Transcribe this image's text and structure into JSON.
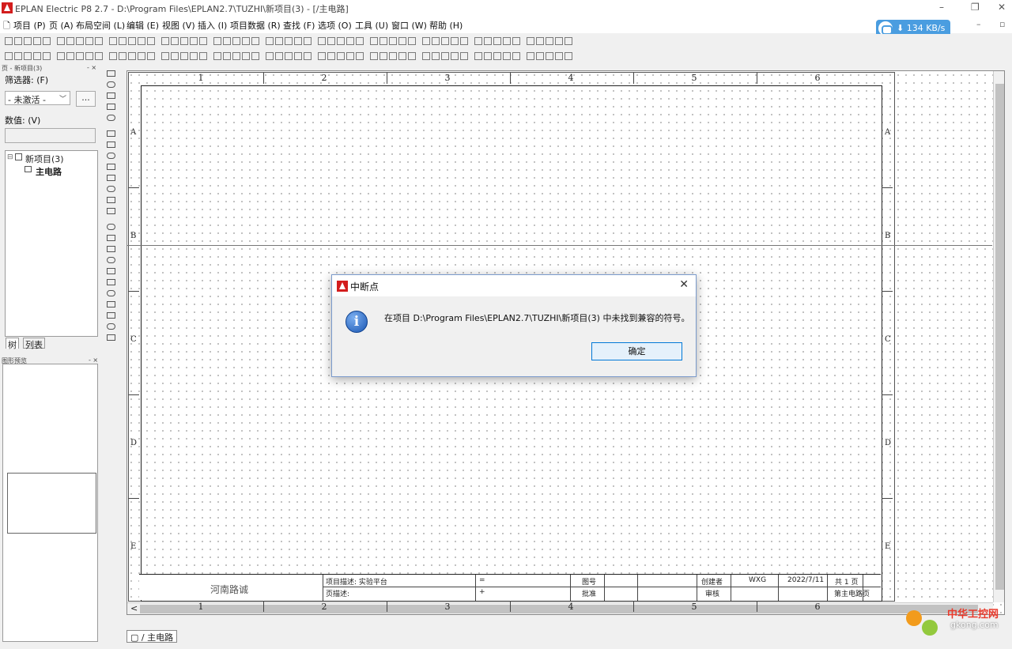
{
  "window": {
    "title": "EPLAN Electric P8 2.7 - D:\\Program Files\\EPLAN2.7\\TUZHI\\新项目(3) - [/主电路]",
    "controls": [
      "–",
      "❐",
      "✕"
    ],
    "mdi_controls": [
      "–",
      "▫"
    ]
  },
  "menu": [
    "项目 (P)",
    "页 (A)",
    "布局空间 (L)",
    "编辑 (E)",
    "视图 (V)",
    "插入 (I)",
    "项目数据 (R)",
    "查找 (F)",
    "选项 (O)",
    "工具 (U)",
    "窗口 (W)",
    "帮助 (H)"
  ],
  "net_speed": "134 KB/s",
  "left_panel": {
    "header": "页 - 新项目(3)",
    "filter_label": "筛选器: (F)",
    "filter_value": "- 未激活 -",
    "dots_button": "...",
    "value_label": "数值: (V)",
    "tree": {
      "project": "新项目(3)",
      "page": "主电路"
    },
    "tabs": [
      "树",
      "列表"
    ],
    "preview_header": "图形预览"
  },
  "sheet": {
    "columns": [
      "1",
      "2",
      "3",
      "4",
      "5",
      "6"
    ],
    "rows": [
      "A",
      "B",
      "C",
      "D",
      "E"
    ],
    "title_block": {
      "company": "河南路诚",
      "project_desc": "项目描述: 实验平台",
      "page_desc": "页描述:",
      "eq_sign": "=",
      "plus_sign": "+",
      "drawing_no_label": "图号",
      "approve_label": "批准",
      "creator_label": "创建者",
      "creator_value": "WXG",
      "date": "2022/7/11",
      "review_label": "审核",
      "total_pages": "共   1   页",
      "page_name": "第主电路页"
    }
  },
  "page_tab": "/ 主电路",
  "dialog": {
    "title": "中断点",
    "message": "在项目 D:\\Program Files\\EPLAN2.7\\TUZHI\\新项目(3) 中未找到兼容的符号。",
    "ok_label": "确定"
  },
  "watermark": {
    "text": "中华工控网",
    "url": "gkong.com"
  }
}
